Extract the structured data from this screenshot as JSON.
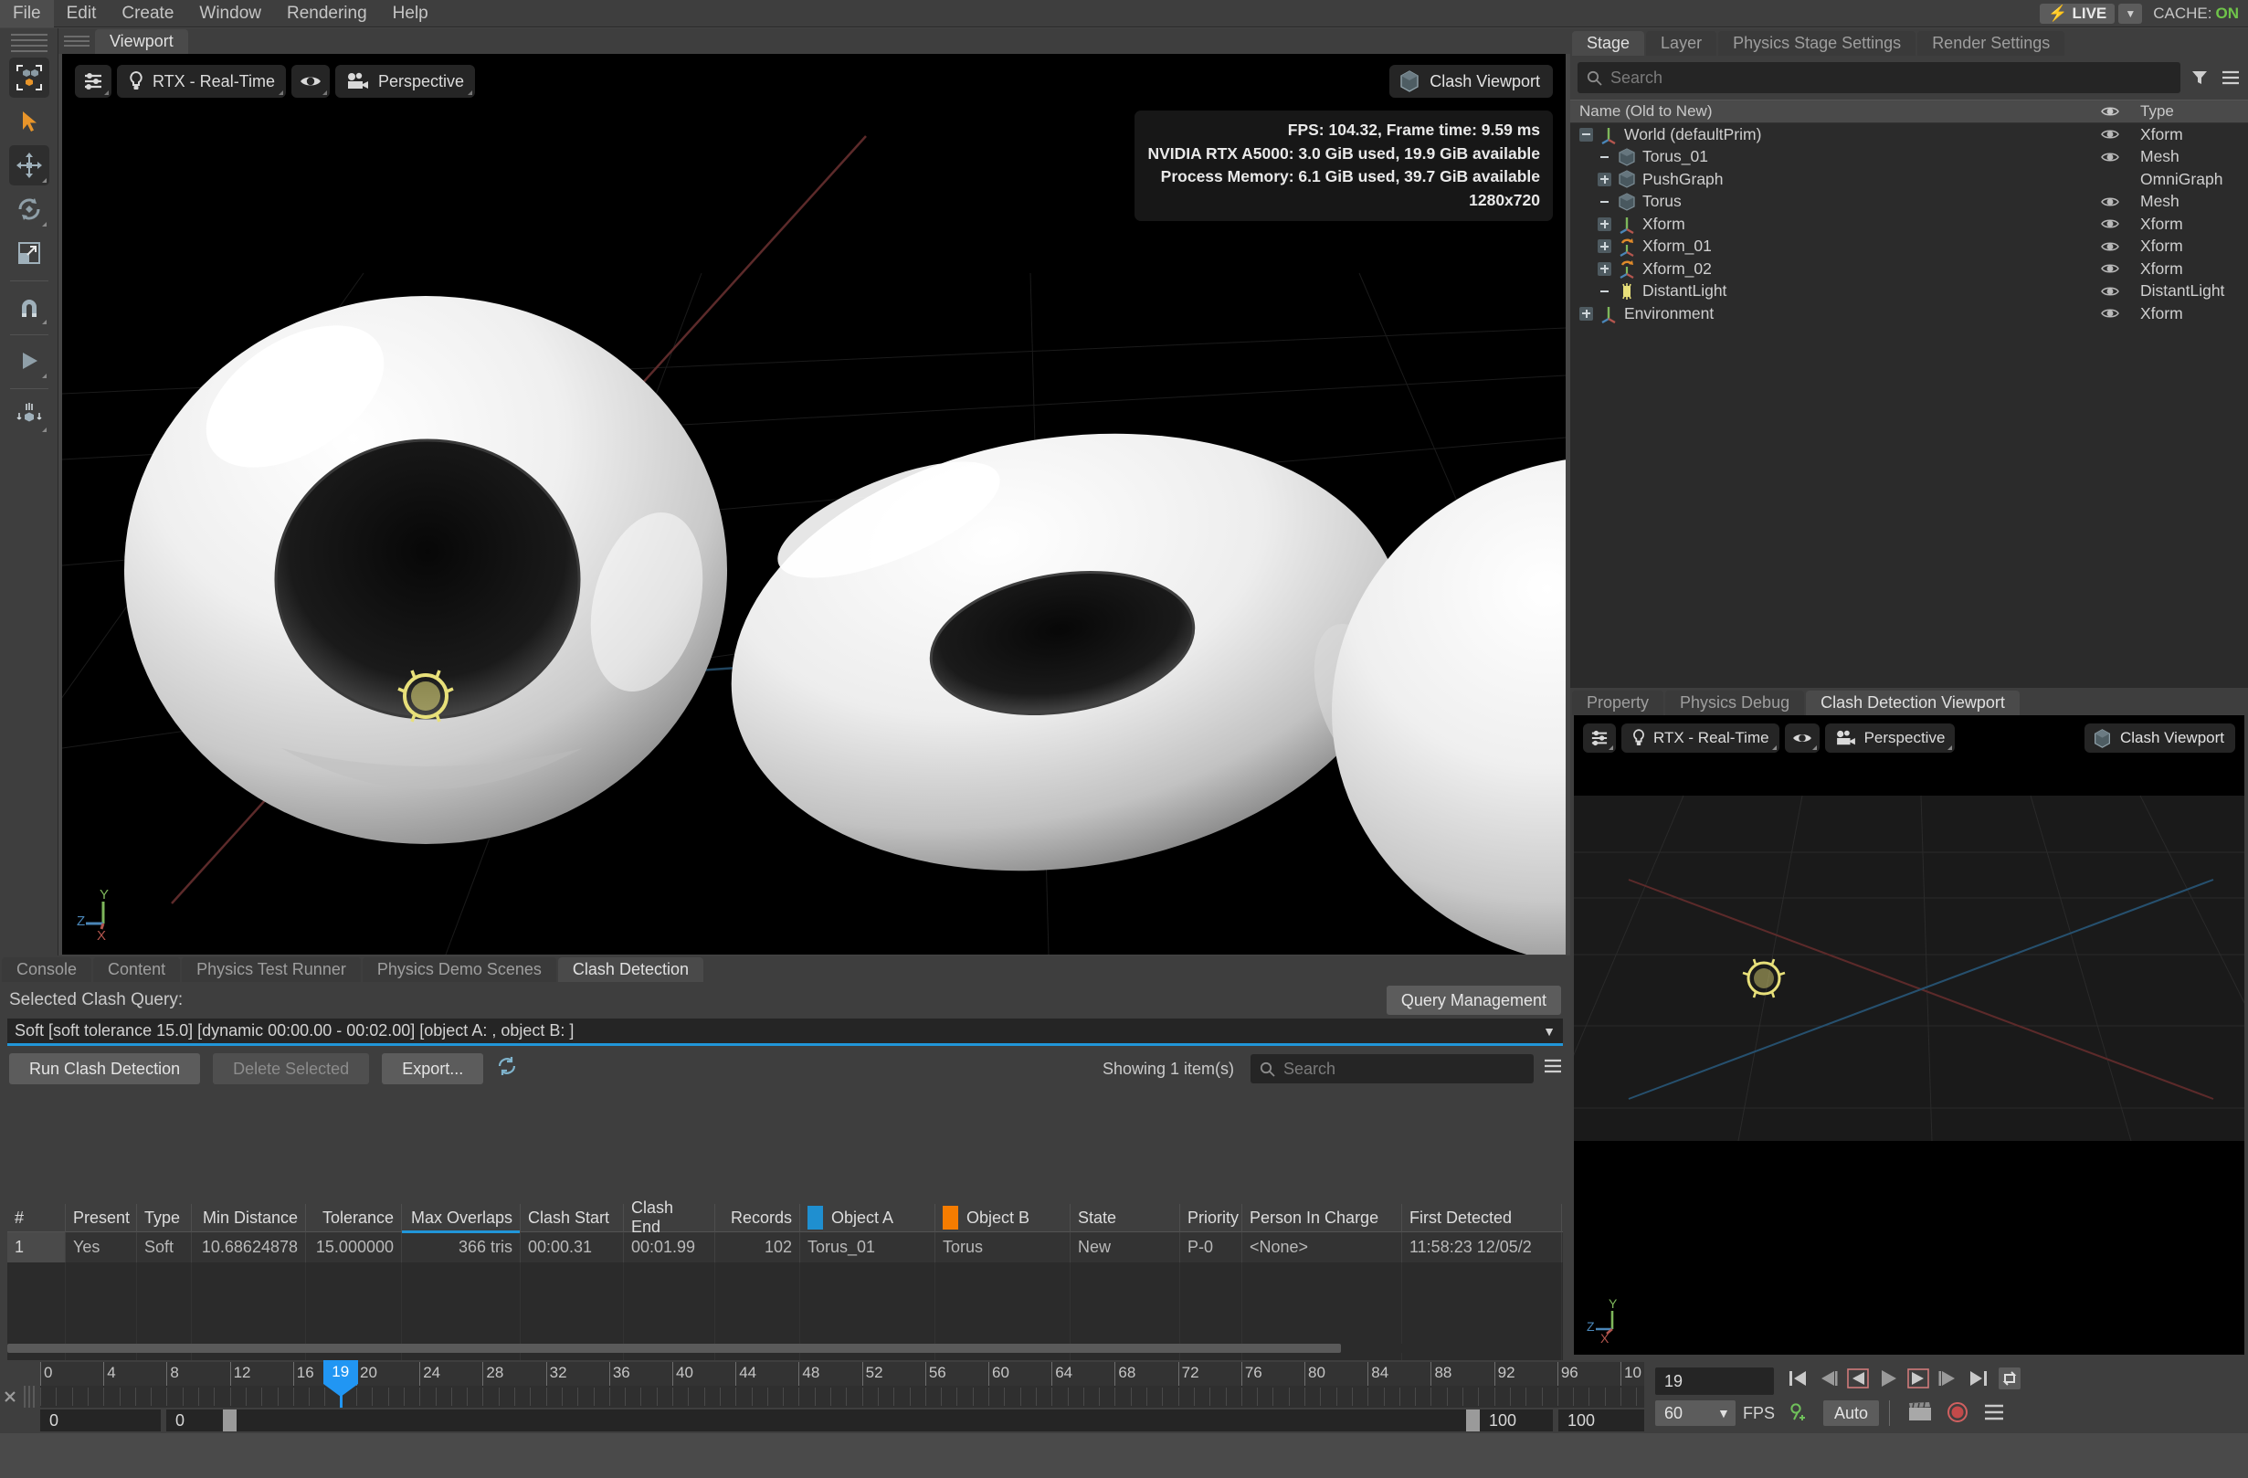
{
  "menubar": {
    "items": [
      "File",
      "Edit",
      "Create",
      "Window",
      "Rendering",
      "Help"
    ],
    "live_label": "LIVE",
    "live_icon": "bolt-icon",
    "cache_label": "CACHE:",
    "cache_state": "ON",
    "cache_state_color": "#6fc44a"
  },
  "left_toolbar": {
    "items": [
      {
        "name": "select-mode-tool",
        "icon": "select-cubes-icon",
        "active": true
      },
      {
        "name": "select-tool",
        "icon": "arrow-cursor-icon",
        "active": false
      },
      {
        "name": "move-tool",
        "icon": "move-gizmo-icon",
        "active": true
      },
      {
        "name": "rotate-tool",
        "icon": "rotate-gizmo-icon",
        "active": false
      },
      {
        "name": "scale-tool",
        "icon": "scale-gizmo-icon",
        "active": false
      },
      {
        "name": "snap-tool",
        "icon": "magnet-icon",
        "active": false
      },
      {
        "name": "play-tool",
        "icon": "play-triangle-icon",
        "active": false
      },
      {
        "name": "physics-drop-tool",
        "icon": "drop-cube-icon",
        "active": false
      }
    ]
  },
  "viewport": {
    "tabs": [
      {
        "label": "Viewport",
        "active": true
      }
    ],
    "toolbar": {
      "settings_icon": "sliders-icon",
      "renderer_icon": "lightbulb-icon",
      "renderer_label": "RTX - Real-Time",
      "visibility_icon": "eye-icon",
      "camera_icon": "camera-icon",
      "camera_label": "Perspective"
    },
    "clash_viewport_button": {
      "label": "Clash Viewport",
      "icon": "cube-icon"
    },
    "hud": {
      "line1": "FPS: 104.32, Frame time: 9.59 ms",
      "line2": "NVIDIA RTX A5000: 3.0 GiB used, 19.9 GiB available",
      "line3": "Process Memory: 6.1 GiB used, 39.7 GiB available",
      "line4": "1280x720"
    },
    "axis_gizmo": {
      "x": "X",
      "y": "Y",
      "z": "Z",
      "x_color": "#b4564e",
      "y_color": "#7eb75b",
      "z_color": "#4a86b8"
    }
  },
  "stage_panel": {
    "tabs": [
      {
        "label": "Stage",
        "active": true
      },
      {
        "label": "Layer",
        "active": false
      },
      {
        "label": "Physics Stage Settings",
        "active": false
      },
      {
        "label": "Render Settings",
        "active": false
      }
    ],
    "search": {
      "placeholder": "Search",
      "value": "",
      "icon": "search-icon"
    },
    "filter_icon": "filter-icon",
    "options_icon": "hamburger-icon",
    "columns": {
      "name": "Name (Old to New)",
      "eye": "eye-icon",
      "type": "Type"
    },
    "rows": [
      {
        "label": "World (defaultPrim)",
        "type": "Xform",
        "indent": 0,
        "expander": "minus",
        "icon": "xform-axis-icon",
        "eye": true
      },
      {
        "label": "Torus_01",
        "type": "Mesh",
        "indent": 1,
        "expander": "none",
        "icon": "mesh-cube-icon",
        "eye": true
      },
      {
        "label": "PushGraph",
        "type": "OmniGraph",
        "indent": 1,
        "expander": "plus",
        "icon": "mesh-cube-icon",
        "eye": false
      },
      {
        "label": "Torus",
        "type": "Mesh",
        "indent": 1,
        "expander": "none",
        "icon": "mesh-cube-icon",
        "eye": true
      },
      {
        "label": "Xform",
        "type": "Xform",
        "indent": 1,
        "expander": "plus",
        "icon": "xform-axis-icon",
        "eye": true
      },
      {
        "label": "Xform_01",
        "type": "Xform",
        "indent": 1,
        "expander": "plus",
        "icon": "xform-anim-icon",
        "eye": true
      },
      {
        "label": "Xform_02",
        "type": "Xform",
        "indent": 1,
        "expander": "plus",
        "icon": "xform-anim-icon",
        "eye": true
      },
      {
        "label": "DistantLight",
        "type": "DistantLight",
        "indent": 1,
        "expander": "none",
        "icon": "light-icon",
        "eye": true
      },
      {
        "label": "Environment",
        "type": "Xform",
        "indent": 0,
        "expander": "plus",
        "icon": "xform-axis-icon",
        "eye": true
      }
    ]
  },
  "clash_panel": {
    "tabs": [
      {
        "label": "Property",
        "active": false
      },
      {
        "label": "Physics Debug",
        "active": false
      },
      {
        "label": "Clash Detection Viewport",
        "active": true
      }
    ],
    "toolbar": {
      "settings_icon": "sliders-icon",
      "renderer_icon": "lightbulb-icon",
      "renderer_label": "RTX - Real-Time",
      "visibility_icon": "eye-icon",
      "camera_icon": "camera-icon",
      "camera_label": "Perspective"
    },
    "clash_viewport_button": {
      "label": "Clash Viewport",
      "icon": "cube-icon"
    },
    "axis_gizmo": {
      "x": "X",
      "y": "Y",
      "z": "Z"
    }
  },
  "bottom_panel": {
    "tabs": [
      {
        "label": "Console",
        "active": false
      },
      {
        "label": "Content",
        "active": false
      },
      {
        "label": "Physics Test Runner",
        "active": false
      },
      {
        "label": "Physics Demo Scenes",
        "active": false
      },
      {
        "label": "Clash Detection",
        "active": true
      }
    ],
    "selected_clash_query_label": "Selected Clash Query:",
    "query_management_button": "Query Management",
    "query_value": "Soft [soft tolerance 15.0] [dynamic 00:00.00 - 00:02.00] [object A: , object B: ]",
    "buttons": {
      "run": "Run Clash Detection",
      "delete": "Delete Selected",
      "export": "Export...",
      "refresh_icon": "refresh-icon"
    },
    "showing_label": "Showing 1 item(s)",
    "table_search": {
      "placeholder": "Search",
      "value": "",
      "icon": "search-icon"
    },
    "table_options_icon": "hamburger-icon",
    "table": {
      "columns": [
        {
          "label": "#",
          "width": 64,
          "align": "left"
        },
        {
          "label": "Present",
          "width": 78,
          "align": "left"
        },
        {
          "label": "Type",
          "width": 60,
          "align": "left"
        },
        {
          "label": "Min Distance",
          "width": 125,
          "align": "right"
        },
        {
          "label": "Tolerance",
          "width": 105,
          "align": "right"
        },
        {
          "label": "Max Overlaps",
          "width": 130,
          "align": "right",
          "sorted": true
        },
        {
          "label": "Clash Start",
          "width": 113,
          "align": "left"
        },
        {
          "label": "Clash End",
          "width": 100,
          "align": "left"
        },
        {
          "label": "Records",
          "width": 93,
          "align": "right"
        },
        {
          "label": "Object A",
          "width": 148,
          "align": "left",
          "swatch": "#1f8fd0"
        },
        {
          "label": "Object B",
          "width": 148,
          "align": "left",
          "swatch": "#f57c00"
        },
        {
          "label": "State",
          "width": 120,
          "align": "left"
        },
        {
          "label": "Priority",
          "width": 68,
          "align": "left"
        },
        {
          "label": "Person In Charge",
          "width": 175,
          "align": "left"
        },
        {
          "label": "First Detected",
          "width": 175,
          "align": "left"
        }
      ],
      "rows": [
        {
          "index": "1",
          "present": "Yes",
          "type": "Soft",
          "min_distance": "10.68624878",
          "tolerance": "15.000000",
          "max_overlaps": "366  tris",
          "clash_start": "00:00.31",
          "clash_end": "00:01.99",
          "records": "102",
          "object_a": "Torus_01",
          "object_b": "Torus",
          "state": "New",
          "priority": "P-0",
          "person_in_charge": "<None>",
          "first_detected": "11:58:23 12/05/2"
        }
      ]
    }
  },
  "timeline": {
    "close_icon": "close-icon",
    "ruler_labels": [
      "0",
      "4",
      "8",
      "12",
      "16",
      "20",
      "24",
      "28",
      "32",
      "36",
      "40",
      "44",
      "48",
      "52",
      "56",
      "60",
      "64",
      "68",
      "72",
      "76",
      "80",
      "84",
      "88",
      "92",
      "96",
      "10"
    ],
    "current_frame_marker": "19",
    "start_field": "0",
    "range_start_field": "0",
    "range_end_field": "100",
    "end_field": "100",
    "frame_input": "19",
    "fps_value": "60",
    "fps_label": "FPS",
    "auto_label": "Auto",
    "transport_icons": [
      "skip-start-icon",
      "step-back-fast-icon",
      "step-back-icon",
      "play-icon",
      "step-forward-icon",
      "step-forward-fast-icon",
      "skip-end-icon",
      "loop-icon"
    ],
    "key_icon": "add-key-icon",
    "clapboard_icon": "clapboard-icon",
    "record_icon": "record-icon",
    "menu_icon": "hamburger-icon"
  }
}
